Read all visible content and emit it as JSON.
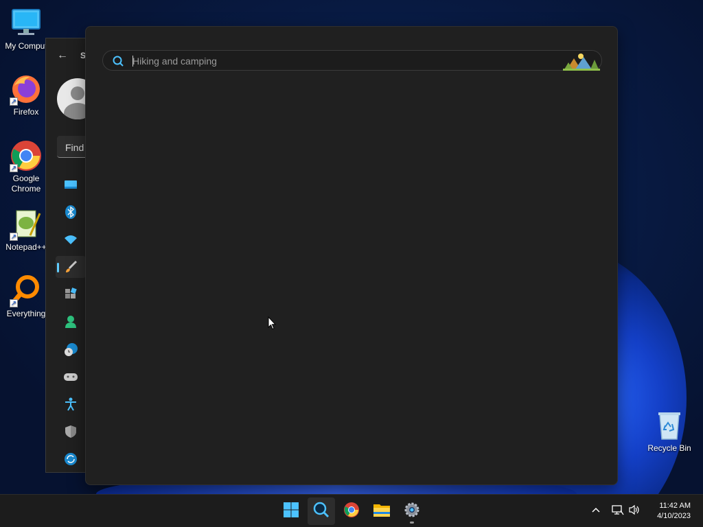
{
  "desktop": {
    "icons": [
      {
        "label": "My Comput",
        "icon": "computer-icon"
      },
      {
        "label": "Firefox",
        "icon": "firefox-icon"
      },
      {
        "label": "Google Chrome",
        "icon": "chrome-icon"
      },
      {
        "label": "Notepad++",
        "icon": "notepadpp-icon"
      },
      {
        "label": "Everything",
        "icon": "everything-icon"
      },
      {
        "label": "Recycle Bin",
        "icon": "recycle-bin-icon"
      }
    ]
  },
  "settings_window": {
    "title": "S",
    "find_placeholder": "Find",
    "nav_icons": [
      "system-icon",
      "bluetooth-icon",
      "network-icon",
      "personalization-icon",
      "apps-icon",
      "accounts-icon",
      "time-language-icon",
      "gaming-icon",
      "accessibility-icon",
      "privacy-security-icon",
      "windows-update-icon"
    ],
    "active_nav": "personalization-icon"
  },
  "search_flyout": {
    "placeholder": "Hiking and camping",
    "highlight_icon": "search-highlight-camping-icon"
  },
  "taskbar": {
    "apps": [
      {
        "name": "start-button",
        "icon": "windows-logo-icon",
        "active": false
      },
      {
        "name": "search-button",
        "icon": "search-icon",
        "active": true
      },
      {
        "name": "chrome-taskbar-button",
        "icon": "chrome-icon",
        "active": false
      },
      {
        "name": "file-explorer-button",
        "icon": "folder-icon",
        "active": false
      },
      {
        "name": "settings-taskbar-button",
        "icon": "gear-icon",
        "active": false,
        "running": true
      }
    ],
    "tray_icons": [
      "chevron-up-icon",
      "network-icon",
      "volume-icon"
    ],
    "time": "11:42 AM",
    "date": "4/10/2023"
  },
  "colors": {
    "accent": "#60cdff",
    "flyout_bg": "#202020",
    "taskbar_bg": "#1c1c1c"
  }
}
